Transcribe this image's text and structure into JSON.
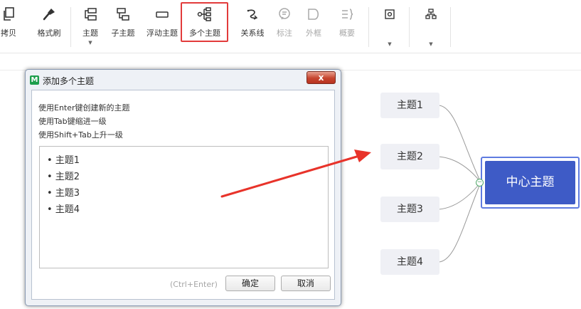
{
  "toolbar": {
    "items": [
      {
        "label": "拷贝",
        "icon": "copy-icon"
      },
      {
        "label": "格式刷",
        "icon": "format-painter-icon"
      },
      {
        "label": "主题",
        "icon": "topic-icon",
        "has_dropdown": true
      },
      {
        "label": "子主题",
        "icon": "subtopic-icon"
      },
      {
        "label": "浮动主题",
        "icon": "floating-topic-icon"
      },
      {
        "label": "多个主题",
        "icon": "multiple-topics-icon",
        "highlighted": true
      },
      {
        "label": "关系线",
        "icon": "relationship-icon"
      },
      {
        "label": "标注",
        "icon": "callout-icon",
        "disabled": true
      },
      {
        "label": "外框",
        "icon": "boundary-icon",
        "disabled": true
      },
      {
        "label": "概要",
        "icon": "summary-icon",
        "disabled": true
      },
      {
        "label": "",
        "icon": "insert-image-icon",
        "has_dropdown": true
      },
      {
        "label": "",
        "icon": "structure-icon",
        "has_dropdown": true
      }
    ],
    "highlight_color": "#e23b3b"
  },
  "dialog": {
    "title": "添加多个主题",
    "close_label": "x",
    "hints": [
      "使用Enter键创建新的主题",
      "使用Tab键缩进一级",
      "使用Shift+Tab上升一级"
    ],
    "topics": [
      "• 主题1",
      "• 主题2",
      "• 主题3",
      "• 主题4"
    ],
    "shortcut": "(Ctrl+Enter)",
    "ok_label": "确定",
    "cancel_label": "取消"
  },
  "mindmap": {
    "central_topic": "中心主题",
    "topics": [
      "主题1",
      "主题2",
      "主题3",
      "主题4"
    ],
    "central_color": "#3e5bc6",
    "topic_color": "#eff0f5"
  },
  "annotation": {
    "arrow_color": "#e8332a"
  }
}
